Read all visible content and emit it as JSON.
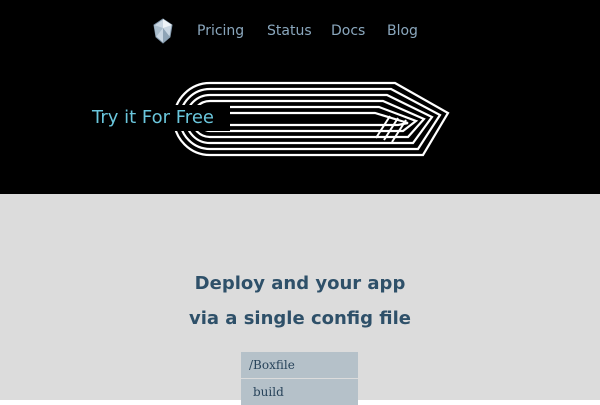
{
  "nav": {
    "logo_icon": "gem-logo-icon",
    "links": [
      "Pricing",
      "Status",
      "Docs",
      "Blog"
    ]
  },
  "hero": {
    "cta_label": "Try it For Free"
  },
  "main": {
    "headline_line1": "Deploy and your app",
    "headline_line2": "via a single config file",
    "code_lines": [
      "/Boxfile",
      "build"
    ]
  },
  "colors": {
    "header_bg": "#000000",
    "nav_link": "#8aa7bd",
    "cta_text": "#6ac6dc",
    "main_bg": "#dcdcdc",
    "headline": "#2e5069",
    "code_bg": "#b5c1c9"
  }
}
